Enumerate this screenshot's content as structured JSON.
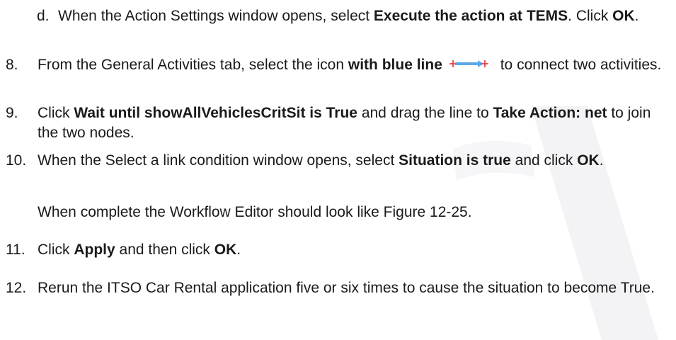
{
  "steps": {
    "d": {
      "num": "d.",
      "t1": "When the Action Settings window opens, select ",
      "b1": "Execute the action at TEMS",
      "t2": ". Click ",
      "b2": "OK",
      "t3": "."
    },
    "s8": {
      "num": "8.",
      "t1": "From the General Activities tab, select the icon ",
      "b1": "with blue line",
      "t2": " to connect two activities."
    },
    "s9": {
      "num": "9.",
      "t1": "Click ",
      "b1": "Wait until showAllVehiclesCritSit is True",
      "t2": " and drag the line to ",
      "b2": "Take Action: net",
      "t3": " to join the two nodes."
    },
    "s10": {
      "num": "10.",
      "t1": "When the Select a link condition window opens, select ",
      "b1": "Situation is true",
      "t2": " and click ",
      "b2": "OK",
      "t3": "."
    },
    "p10": "When complete the Workflow Editor should look like Figure 12-25.",
    "s11": {
      "num": "11.",
      "t1": "Click ",
      "b1": "Apply",
      "t2": " and then click ",
      "b2": "OK",
      "t3": "."
    },
    "s12": {
      "num": "12.",
      "t1": "Rerun the ITSO Car Rental application five or six times to cause the situation to become True."
    }
  },
  "icons": {
    "link_tool": "blue-line-connector-icon"
  },
  "colors": {
    "text": "#1a1a1a",
    "link_line": "#5aa8e8",
    "link_ends": "#e8303a",
    "watermark": "#f4f4f6"
  }
}
